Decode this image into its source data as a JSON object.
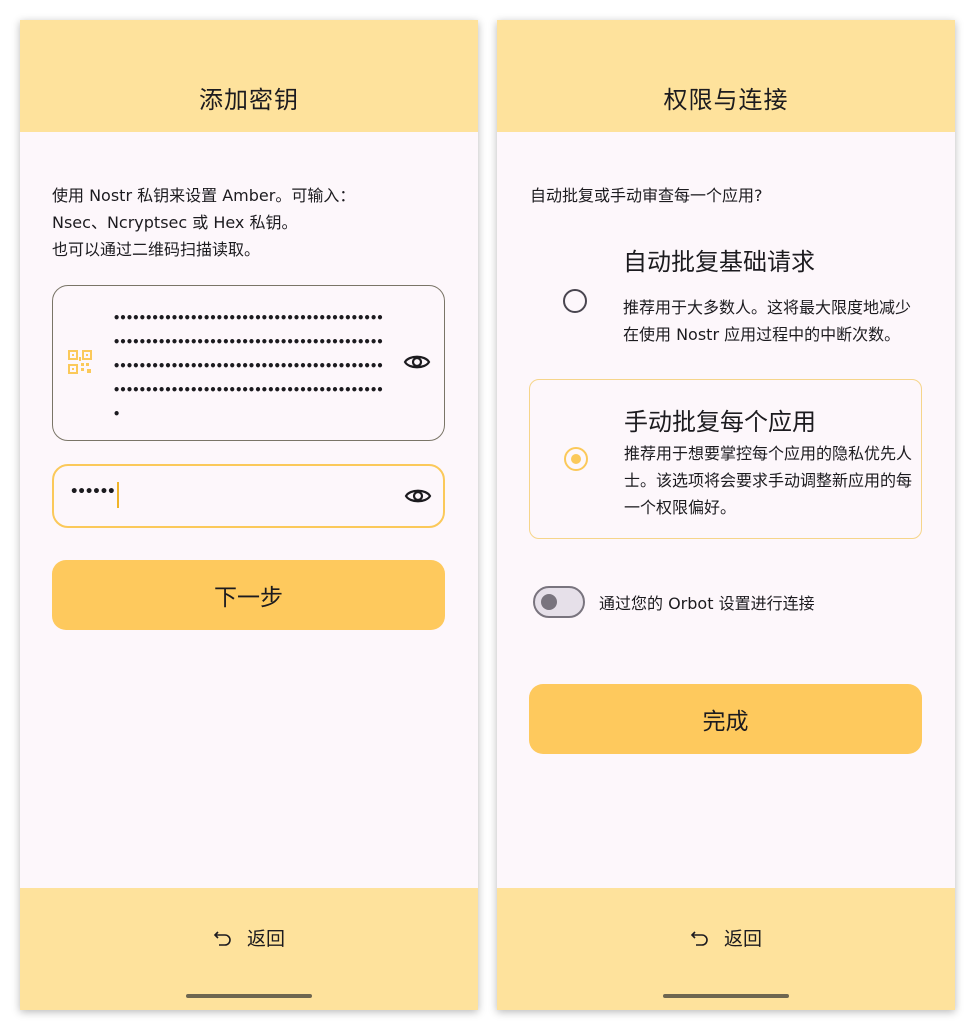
{
  "left_screen": {
    "title": "添加密钥",
    "intro_lines": [
      "使用 Nostr 私钥来设置 Amber。可输入：",
      "Nsec、Ncryptsec 或 Hex 私钥。",
      "也可以通过二维码扫描读取。"
    ],
    "key_field": {
      "masked_value": "•••••••••••••••••••••••••••••••••••••••••••••••••••••••••••••••••••••••••••••••••••••••••••••••••••••••••••••••••••••••••••••••••••••••••••••••••••••••••••••••••••••••••",
      "leading_icon": "qr-code-icon",
      "trailing_icon": "eye-icon"
    },
    "password_field": {
      "masked_value": "••••••",
      "trailing_icon": "eye-icon"
    },
    "next_label": "下一步",
    "back_label": "返回"
  },
  "right_screen": {
    "title": "权限与连接",
    "question": "自动批复或手动审查每一个应用?",
    "option_auto": {
      "title": "自动批复基础请求",
      "description": "推荐用于大多数人。这将最大限度地减少在使用 Nostr 应用过程中的中断次数。",
      "selected": false
    },
    "option_manual": {
      "title": "手动批复每个应用",
      "description": "推荐用于想要掌控每个应用的隐私优先人士。该选项将会要求手动调整新应用的每一个权限偏好。",
      "selected": true
    },
    "orbot_toggle": {
      "label": "通过您的 Orbot 设置进行连接",
      "enabled": false
    },
    "done_label": "完成",
    "back_label": "返回"
  },
  "colors": {
    "bar_background": "#fee29c",
    "primary_button": "#fec95d",
    "accent": "#fbc95a",
    "surface": "#fdf7fb"
  }
}
